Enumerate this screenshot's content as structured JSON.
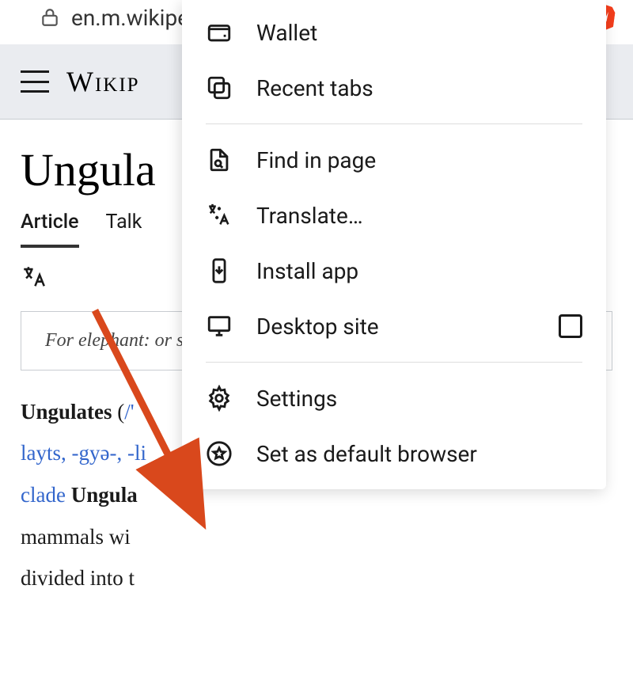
{
  "url": "en.m.wikipedia.org/wiki/Ungulate",
  "wiki_logo_text": "Wikip",
  "article": {
    "title": "Ungula",
    "tabs": {
      "article": "Article",
      "talk": "Talk"
    },
    "note": "For elephant: or subungula",
    "body_html": "<b>Ungulates</b> (<a>/'</a><br><a>layts, -gyə-, -li</a><br><a>clade</a> <b>Ungula</b><br>mammals wi<br>divided into t"
  },
  "menu": {
    "wallet": "Wallet",
    "recent_tabs": "Recent tabs",
    "find_in_page": "Find in page",
    "translate": "Translate…",
    "install_app": "Install app",
    "desktop_site": "Desktop site",
    "settings": "Settings",
    "set_default": "Set as default browser"
  }
}
